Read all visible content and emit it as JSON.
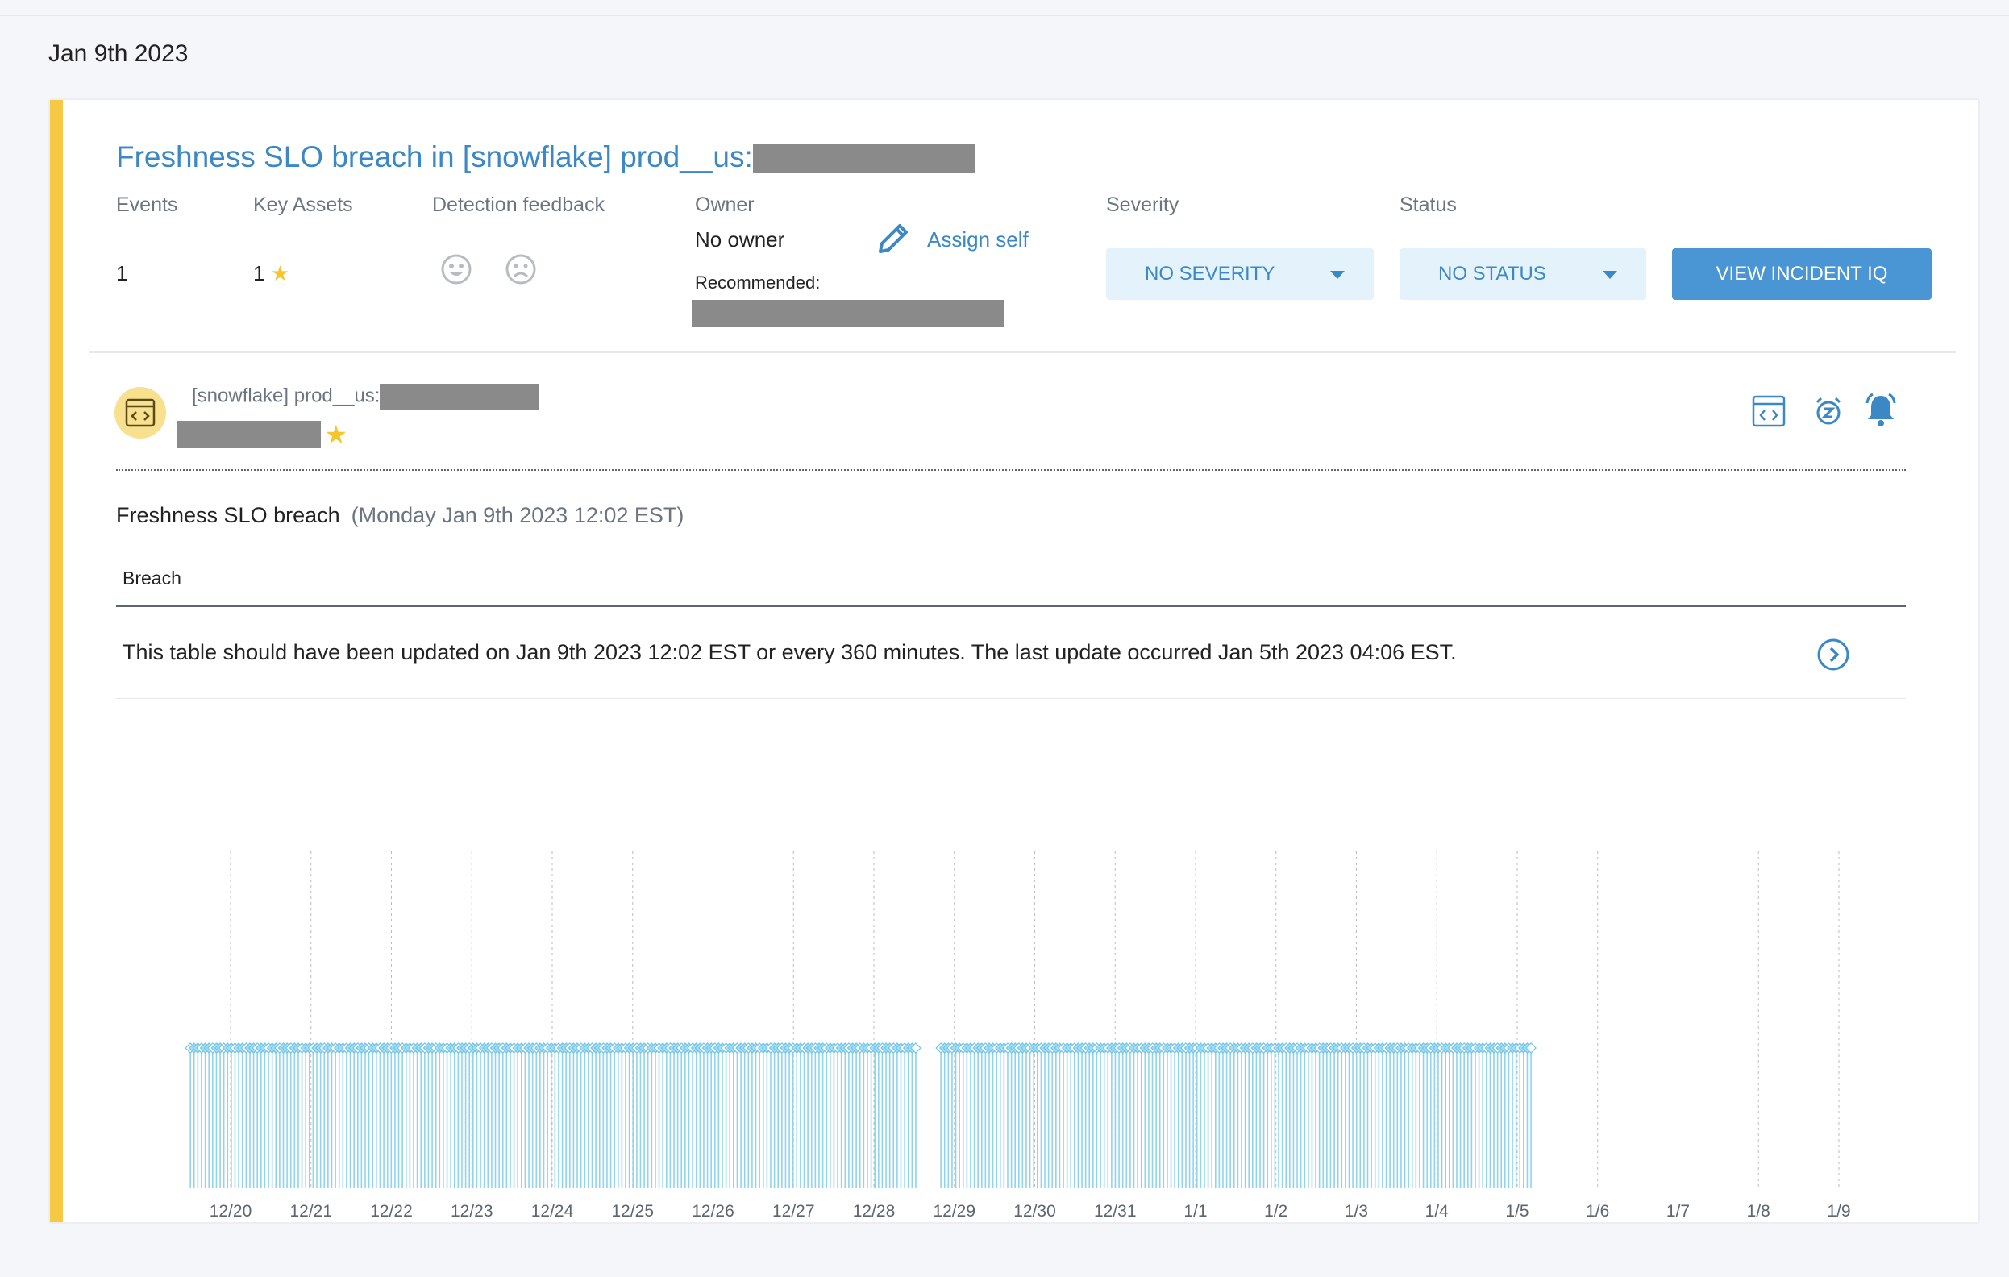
{
  "date_heading": "Jan 9th 2023",
  "incident": {
    "title_prefix": "Freshness SLO breach in [snowflake] prod__us:",
    "columns": {
      "events_label": "Events",
      "events_value": "1",
      "key_assets_label": "Key Assets",
      "key_assets_value": "1",
      "detection_feedback_label": "Detection feedback",
      "owner_label": "Owner",
      "owner_value": "No owner",
      "assign_self": "Assign self",
      "recommended_label": "Recommended:",
      "severity_label": "Severity",
      "status_label": "Status"
    },
    "severity_value": "NO SEVERITY",
    "status_value": "NO STATUS",
    "view_button": "VIEW INCIDENT IQ"
  },
  "asset": {
    "path_prefix": "[snowflake] prod__us:"
  },
  "event": {
    "name": "Freshness SLO breach",
    "timestamp": "(Monday Jan 9th 2023 12:02 EST)",
    "tab": "Breach",
    "message": "This table should have been updated on Jan 9th 2023 12:02 EST or every 360 minutes. The last update occurred Jan 5th 2023 04:06 EST."
  },
  "colors": {
    "accent": "#f6c944",
    "link": "#3c88c4",
    "bar": "#8fd3ee"
  },
  "chart_data": {
    "type": "bar",
    "x_ticks": [
      "12/20",
      "12/21",
      "12/22",
      "12/23",
      "12/24",
      "12/25",
      "12/26",
      "12/27",
      "12/28",
      "12/29",
      "12/30",
      "12/31",
      "1/1",
      "1/2",
      "1/3",
      "1/4",
      "1/5",
      "1/6",
      "1/7",
      "1/8",
      "1/9"
    ],
    "series": [
      {
        "segments": [
          {
            "start": "12/19 12:00",
            "end": "12/28 12:30"
          },
          {
            "start": "12/28 20:00",
            "end": "1/5 04:06"
          }
        ]
      }
    ],
    "grid": "vertical dotted"
  }
}
